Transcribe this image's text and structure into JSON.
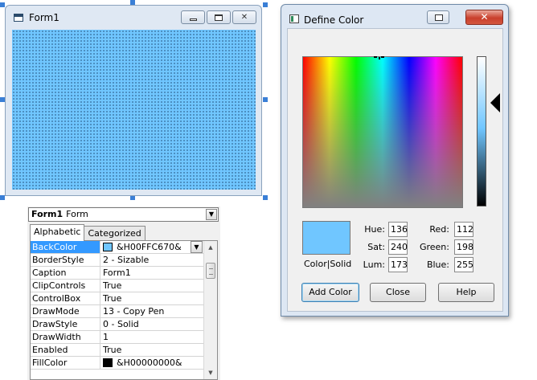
{
  "form1": {
    "title": "Form1",
    "back_color": "#70c6ff"
  },
  "properties": {
    "object_name": "Form1",
    "object_type": "Form",
    "tabs": [
      {
        "label": "Alphabetic",
        "active": true
      },
      {
        "label": "Categorized",
        "active": false
      }
    ],
    "rows": [
      {
        "name": "BackColor",
        "value": "&H00FFC670&",
        "swatch": "#70c6ff",
        "selected": true
      },
      {
        "name": "BorderStyle",
        "value": "2 - Sizable"
      },
      {
        "name": "Caption",
        "value": "Form1"
      },
      {
        "name": "ClipControls",
        "value": "True"
      },
      {
        "name": "ControlBox",
        "value": "True"
      },
      {
        "name": "DrawMode",
        "value": "13 - Copy Pen"
      },
      {
        "name": "DrawStyle",
        "value": "0 - Solid"
      },
      {
        "name": "DrawWidth",
        "value": "1"
      },
      {
        "name": "Enabled",
        "value": "True"
      },
      {
        "name": "FillColor",
        "value": "&H00000000&",
        "swatch": "#000000"
      }
    ]
  },
  "define_color": {
    "title": "Define Color",
    "close_glyph": "✕",
    "color_solid_label": "Color|Solid",
    "hue_label": "Hue:",
    "hue": "136",
    "sat_label": "Sat:",
    "sat": "240",
    "lum_label": "Lum:",
    "lum": "173",
    "red_label": "Red:",
    "red": "112",
    "green_label": "Green:",
    "green": "198",
    "blue_label": "Blue:",
    "blue": "255",
    "add_color_label": "Add Color",
    "close_label": "Close",
    "help_label": "Help",
    "current_color": "#70c6ff"
  }
}
